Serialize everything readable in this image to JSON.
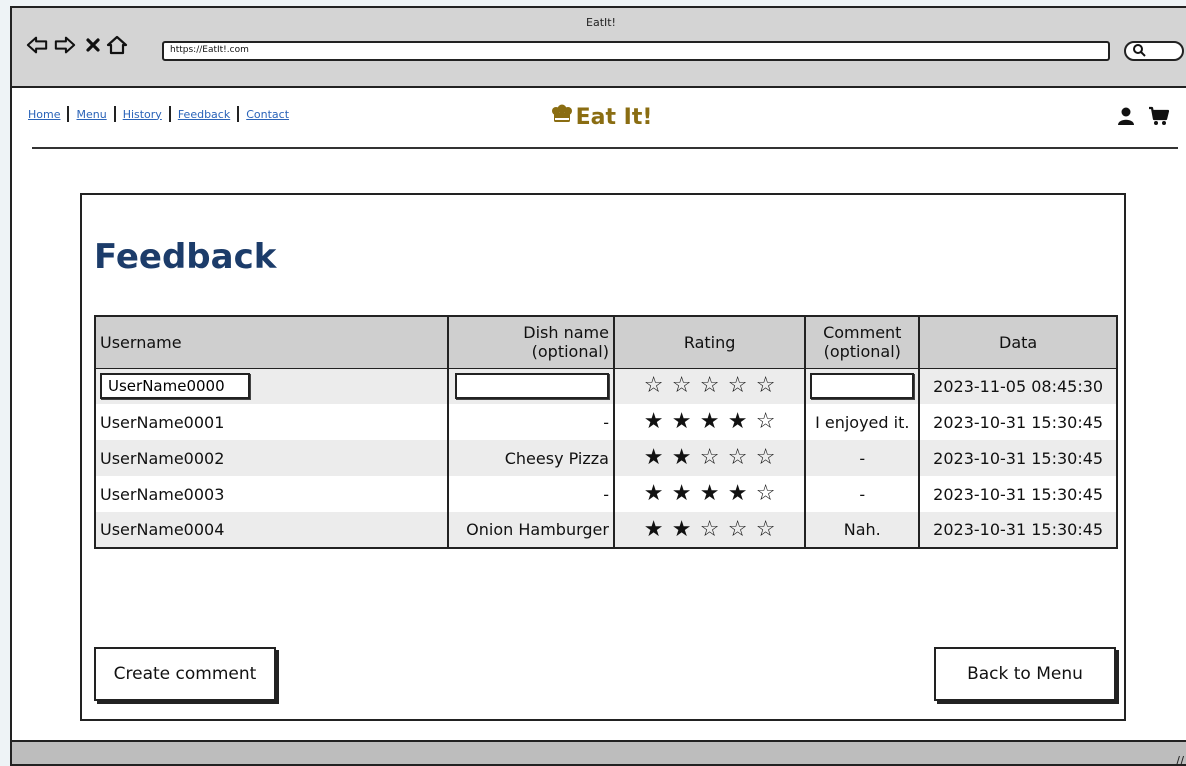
{
  "browser": {
    "title": "EatIt!",
    "url": "https://EatIt!.com"
  },
  "nav": {
    "links": [
      "Home",
      "Menu",
      "History",
      "Feedback",
      "Contact"
    ]
  },
  "logo": {
    "text": "Eat It!"
  },
  "colors": {
    "title": "#1c3c6a",
    "logo": "#8a6d12",
    "link": "#2a63b8",
    "header_bg": "#cfcfcf",
    "row_alt": "#ececec"
  },
  "icons": {
    "back": "arrow-left-icon",
    "forward": "arrow-right-icon",
    "stop": "close-icon",
    "home": "home-icon",
    "search": "search-icon",
    "user": "user-icon",
    "cart": "cart-icon",
    "logo": "chef-logo-icon"
  },
  "page": {
    "title": "Feedback"
  },
  "table": {
    "headers": {
      "username": "Username",
      "dish_line1": "Dish name",
      "dish_line2": "(optional)",
      "rating": "Rating",
      "comment_line1": "Comment",
      "comment_line2": "(optional)",
      "date": "Data"
    },
    "input_row": {
      "username": "UserName0000",
      "dish": "",
      "rating": 0,
      "comment": "",
      "date": "2023-11-05 08:45:30"
    },
    "rows": [
      {
        "username": "UserName0001",
        "dish": "-",
        "rating": 4,
        "comment": "I enjoyed it.",
        "date": "2023-10-31 15:30:45"
      },
      {
        "username": "UserName0002",
        "dish": "Cheesy Pizza",
        "rating": 2,
        "comment": "-",
        "date": "2023-10-31 15:30:45"
      },
      {
        "username": "UserName0003",
        "dish": "-",
        "rating": 4,
        "comment": "-",
        "date": "2023-10-31 15:30:45"
      },
      {
        "username": "UserName0004",
        "dish": "Onion Hamburger",
        "rating": 2,
        "comment": "Nah.",
        "date": "2023-10-31 15:30:45"
      }
    ],
    "max_rating": 5
  },
  "buttons": {
    "create": "Create comment",
    "back": "Back to Menu"
  }
}
